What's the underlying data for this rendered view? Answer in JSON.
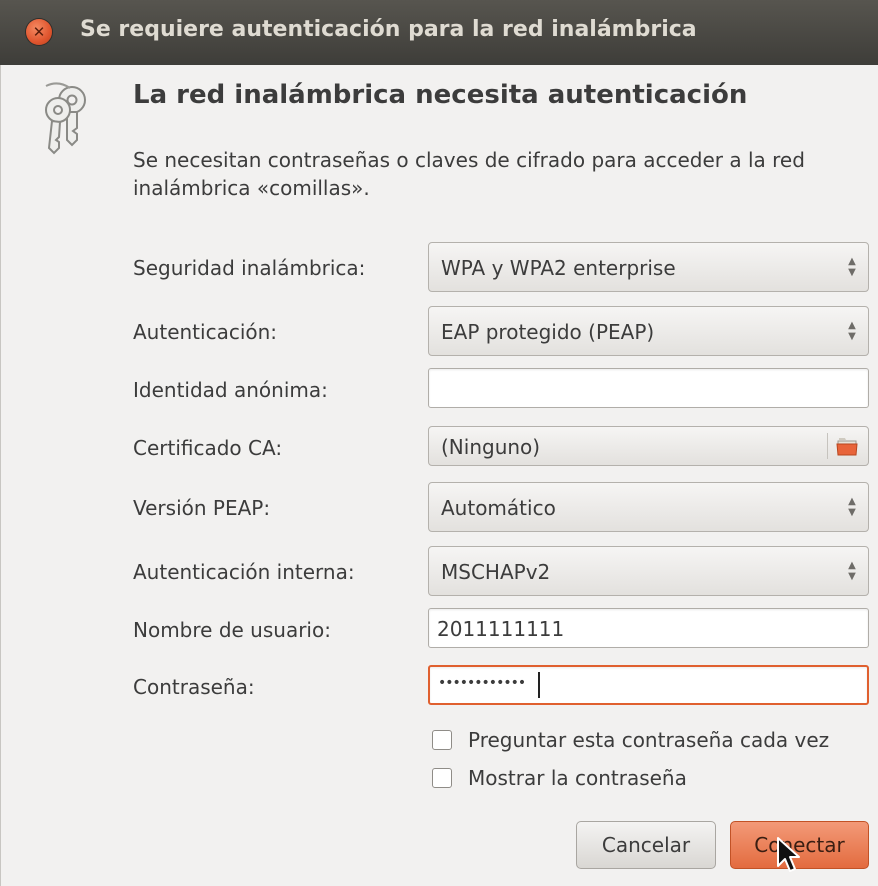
{
  "window": {
    "title": "Se requiere autenticación para la red inalámbrica",
    "close_icon": "close-icon"
  },
  "header": {
    "icon": "keys-icon",
    "heading": "La red inalámbrica necesita autenticación",
    "description": "Se necesitan contraseñas o claves de cifrado para acceder a la red inalámbrica «comillas»."
  },
  "form": {
    "security": {
      "label": "Seguridad inalámbrica:",
      "value": "WPA y WPA2 enterprise"
    },
    "authentication": {
      "label": "Autenticación:",
      "value": "EAP protegido (PEAP)"
    },
    "anonymous_identity": {
      "label": "Identidad anónima:",
      "value": ""
    },
    "ca_certificate": {
      "label": "Certificado CA:",
      "value": "(Ninguno)",
      "icon": "folder-icon"
    },
    "peap_version": {
      "label": "Versión PEAP:",
      "value": "Automático"
    },
    "inner_auth": {
      "label": "Autenticación interna:",
      "value": "MSCHAPv2"
    },
    "username": {
      "label": "Nombre de usuario:",
      "value": "2011111111"
    },
    "password": {
      "label": "Contraseña:",
      "value": "••••••••••••"
    },
    "ask_password": {
      "label": "Preguntar esta contraseña cada vez",
      "checked": false
    },
    "show_password": {
      "label": "Mostrar la contraseña",
      "checked": false
    }
  },
  "buttons": {
    "cancel": "Cancelar",
    "connect": "Conectar"
  },
  "colors": {
    "accent": "#e36b3f",
    "titlebar": "#3e3d39",
    "background": "#f2f1f0"
  }
}
